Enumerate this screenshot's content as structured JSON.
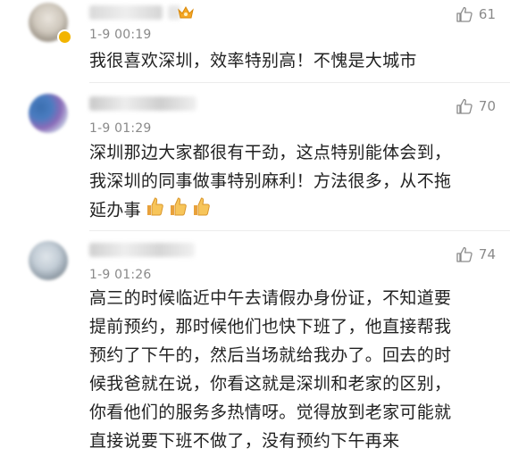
{
  "comments": [
    {
      "time": "1-9 00:19",
      "likes": "61",
      "lines": [
        "我很喜欢深圳，效率特别高！不愧是大城市"
      ]
    },
    {
      "time": "1-9 01:29",
      "likes": "70",
      "lines": [
        "深圳那边大家都很有干劲，这点特别能体会到，",
        "我深圳的同事做事特别麻利！方法很多，从不拖",
        "延办事"
      ],
      "emojis": [
        "thumbs-up",
        "thumbs-up",
        "thumbs-up"
      ]
    },
    {
      "time": "1-9 01:26",
      "likes": "74",
      "lines": [
        "高三的时候临近中午去请假办身份证，不知道要",
        "提前预约，那时候他们也快下班了，他直接帮我",
        "预约了下午的，然后当场就给我办了。回去的时",
        "候我爸就在说，你看这就是深圳和老家的区别，",
        "你看他们的服务多热情呀。觉得放到老家可能就",
        "直接说要下班不做了，没有预约下午再来"
      ]
    }
  ]
}
